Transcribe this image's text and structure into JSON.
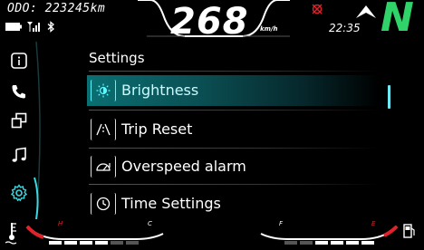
{
  "top": {
    "odometer": "ODO: 223245km",
    "speed": "268",
    "speed_unit": "km/h",
    "clock": "22:35",
    "gear": "N"
  },
  "icons": {
    "battery": "battery-icon",
    "signal": "signal-icon",
    "bluetooth": "bluetooth-icon",
    "warning": "warning-icon",
    "navigation": "navigation-arrow-icon"
  },
  "rail": [
    {
      "name": "info-icon",
      "active": false
    },
    {
      "name": "phone-icon",
      "active": false
    },
    {
      "name": "mirror-icon",
      "active": false
    },
    {
      "name": "music-icon",
      "active": false
    },
    {
      "name": "gear-icon",
      "active": true
    }
  ],
  "settings": {
    "title": "Settings",
    "items": [
      {
        "label": "Brightness",
        "icon": "brightness-icon",
        "selected": true
      },
      {
        "label": "Trip Reset",
        "icon": "trip-reset-icon",
        "selected": false
      },
      {
        "label": "Overspeed alarm",
        "icon": "overspeed-icon",
        "selected": false
      },
      {
        "label": "Time Settings",
        "icon": "clock-icon",
        "selected": false
      }
    ]
  },
  "gauges": {
    "temp_hot": "H",
    "temp_cold": "C",
    "fuel_full": "F",
    "fuel_empty": "E"
  },
  "colors": {
    "accent": "#2fd36a",
    "highlight": "#0a6f72",
    "red": "#e0222a"
  }
}
